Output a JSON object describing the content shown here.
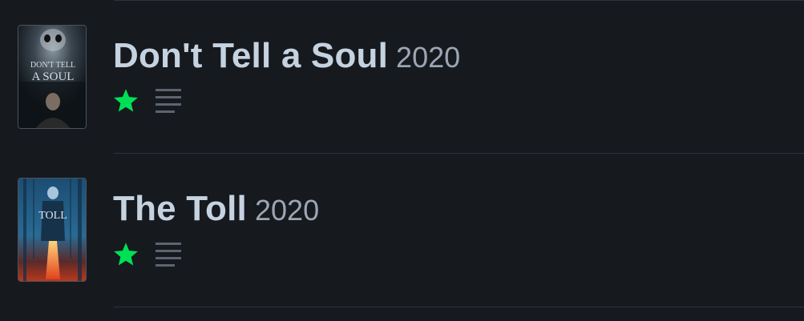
{
  "films": [
    {
      "title": "Don't Tell a Soul",
      "year": "2020",
      "poster_text_line1": "DON'T TELL",
      "poster_text_line2": "A SOUL",
      "liked_icon": "star-icon",
      "review_icon": "lines-icon"
    },
    {
      "title": "The Toll",
      "year": "2020",
      "poster_text_line1": "TOLL",
      "liked_icon": "star-icon",
      "review_icon": "lines-icon"
    }
  ],
  "colors": {
    "background": "#16191e",
    "title": "#c5d2e0",
    "year": "#9aa6b3",
    "star": "#00e054",
    "review_lines": "#5b6571",
    "divider": "#2d3440"
  }
}
